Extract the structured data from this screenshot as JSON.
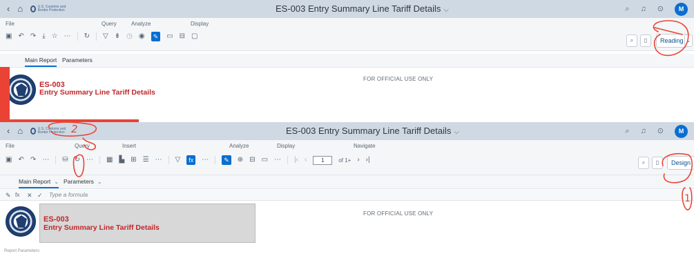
{
  "top": {
    "title": "ES-003 Entry Summary Line Tariff Details",
    "logo_text": "U.S. Customs and Border Protection",
    "avatar": "M",
    "groups": {
      "file": "File",
      "query": "Query",
      "analyze": "Analyze",
      "display": "Display"
    },
    "mode_button": "Reading",
    "tabs": {
      "main": "Main Report",
      "parameters": "Parameters"
    },
    "report": {
      "code": "ES-003",
      "title": "Entry Summary Line Tariff Details",
      "official": "FOR OFFICIAL USE ONLY"
    }
  },
  "bottom": {
    "title": "ES-003 Entry Summary Line Tariff Details",
    "logo_text": "U.S. Customs and Border Protection",
    "avatar": "M",
    "groups": {
      "file": "File",
      "query": "Query",
      "insert": "Insert",
      "analyze": "Analyze",
      "display": "Display",
      "navigate": "Navigate"
    },
    "page_number": "1",
    "page_of": "of 1+",
    "mode_button": "Design",
    "tabs": {
      "main": "Main Report",
      "parameters": "Parameters"
    },
    "formula_placeholder": "Type a formula",
    "report": {
      "code": "ES-003",
      "title": "Entry Summary Line Tariff Details",
      "official": "FOR OFFICIAL USE ONLY"
    },
    "footer_text": "Report Parameters:"
  },
  "annotations": {
    "scribble_number": "2",
    "scribble_one": "1"
  },
  "colors": {
    "shellbar": "#cfd9e3",
    "accent": "#0a6ed1",
    "report_red": "#c0262b",
    "markup_red": "#ea4335"
  },
  "icons": [
    "back-icon",
    "home-icon",
    "search-icon",
    "bell-icon",
    "help-icon",
    "save-icon",
    "undo-icon",
    "redo-icon",
    "download-icon",
    "star-icon",
    "more-icon",
    "refresh-icon",
    "filter-icon",
    "sort-icon",
    "formula-icon",
    "pin-icon",
    "zoom-icon",
    "first-page-icon",
    "prev-page-icon",
    "next-page-icon",
    "last-page-icon"
  ]
}
